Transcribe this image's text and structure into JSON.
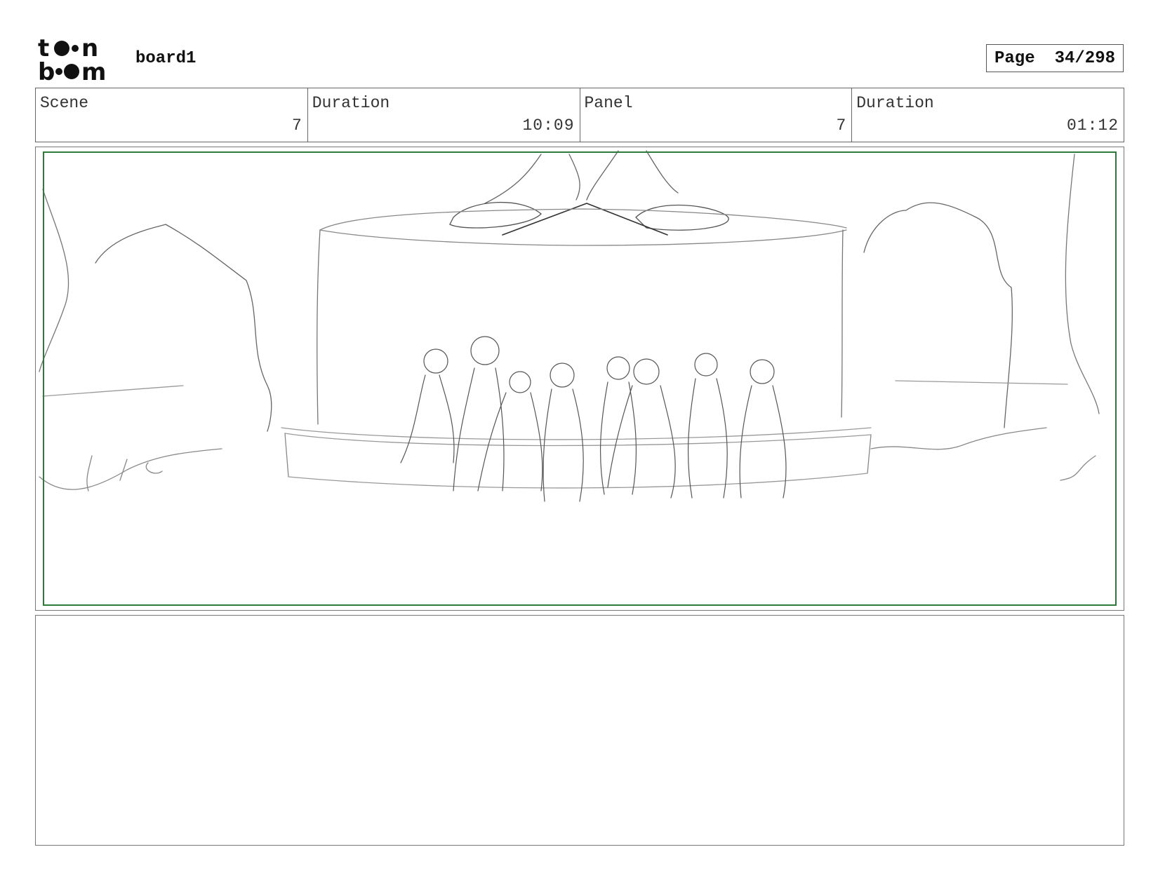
{
  "header": {
    "logo_text": "toon boom",
    "board_title": "board1",
    "page_label": "Page",
    "page_number": "34/298"
  },
  "info": {
    "scene_label": "Scene",
    "scene_value": "7",
    "scene_duration_label": "Duration",
    "scene_duration_value": "10:09",
    "panel_label": "Panel",
    "panel_value": "7",
    "panel_duration_label": "Duration",
    "panel_duration_value": "01:12"
  },
  "panel": {
    "frame_color": "#2f7a3a",
    "sketch_color": "#555555"
  },
  "notes": {
    "text": ""
  }
}
